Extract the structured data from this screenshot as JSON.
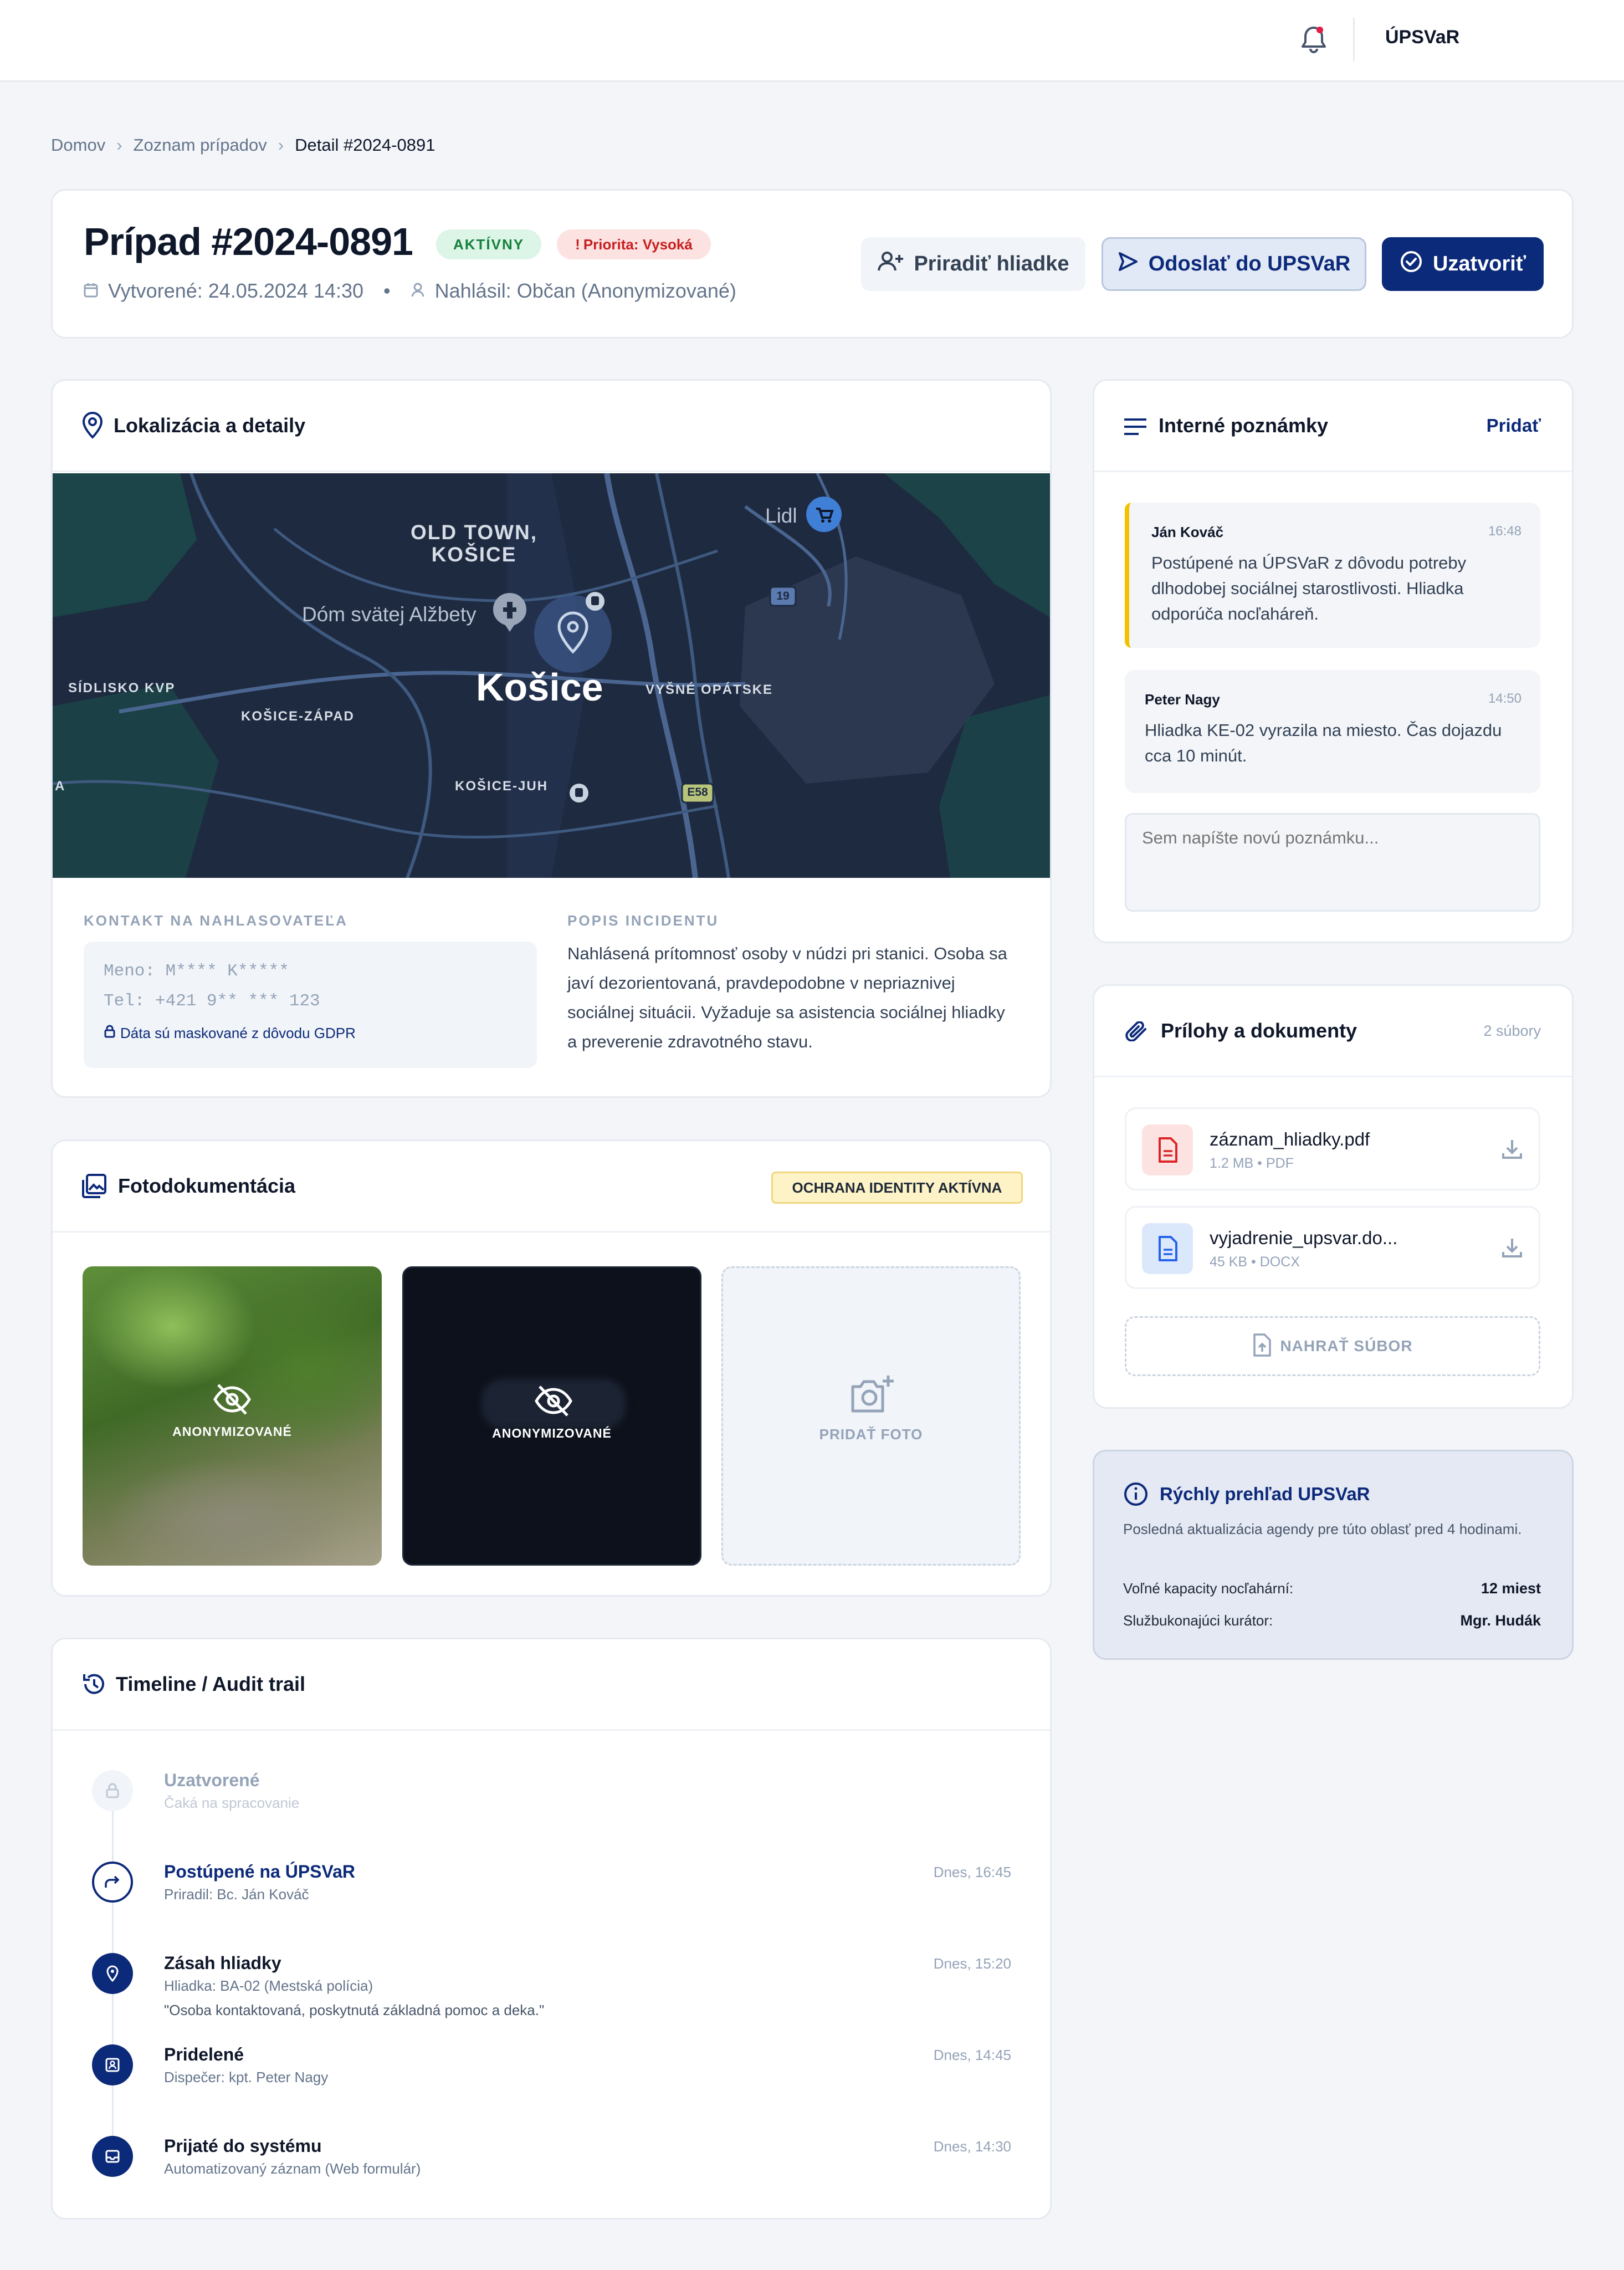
{
  "header": {
    "org_label": "ÚPSVaR"
  },
  "breadcrumb": {
    "items": [
      "Domov",
      "Zoznam prípadov",
      "Detail #2024-0891"
    ],
    "separator": "›"
  },
  "case": {
    "title": "Prípad #2024-0891",
    "status_badge": "AKTÍVNY",
    "priority_badge": "Priorita: Vysoká",
    "priority_mark": "!",
    "created": "Vytvorené: 24.05.2024 14:30",
    "meta_separator": "•",
    "reported_by": "Nahlásil: Občan (Anonymizované)",
    "actions": {
      "assign": "Priradiť hliadke",
      "send": "Odoslať do UPSVaR",
      "close": "Uzatvoriť"
    }
  },
  "location": {
    "title": "Lokalizácia a detaily",
    "map": {
      "city": "Košice",
      "old_town": "OLD TOWN,\nKOŠICE",
      "old_town_line1": "OLD TOWN,",
      "old_town_line2": "KOŠICE",
      "poi_1": "Dóm svätej Alžbety",
      "poi_2": "Lidl",
      "district_kvp": "SÍDLISKO KVP",
      "district_zapad": "KOŠICE-ZÁPAD",
      "district_juh": "KOŠICE-JUH",
      "district_opatske": "VYŠNÉ OPÁTSKE",
      "road_19": "19",
      "road_e58": "E58",
      "edge_letter": "A"
    },
    "contact": {
      "label": "KONTAKT NA NAHLASOVATEĽA",
      "name_line": "Meno: M**** K*****",
      "phone_line": "Tel: +421 9** *** 123",
      "gdpr_note": "Dáta sú maskované z dôvodu GDPR"
    },
    "description": {
      "label": "POPIS INCIDENTU",
      "text": "Nahlásená prítomnosť osoby v núdzi pri stanici. Osoba sa javí dezorientovaná, pravdepodobne v nepriaznivej sociálnej situácii. Vyžaduje sa asistencia sociálnej hliadky a preverenie zdravotného stavu."
    }
  },
  "photos": {
    "title": "Fotodokumentácia",
    "identity_badge": "OCHRANA IDENTITY AKTÍVNA",
    "anon_label_1": "ANONYMIZOVANÉ",
    "anon_label_2": "ANONYMIZOVANÉ",
    "add_photo": "PRIDAŤ FOTO"
  },
  "timeline": {
    "title": "Timeline / Audit trail",
    "items": [
      {
        "title": "Uzatvorené",
        "sub": "Čaká na spracovanie",
        "time": "",
        "icon": "lock-icon"
      },
      {
        "title": "Postúpené na ÚPSVaR",
        "sub": "Priradil: Bc. Ján Kováč",
        "time": "Dnes, 16:45",
        "icon": "forward-icon"
      },
      {
        "title": "Zásah hliadky",
        "sub": "Hliadka: BA-02 (Mestská polícia)",
        "quote": "\"Osoba kontaktovaná, poskytnutá základná pomoc a deka.\"",
        "time": "Dnes, 15:20",
        "icon": "location-icon"
      },
      {
        "title": "Pridelené",
        "sub": "Dispečer: kpt. Peter Nagy",
        "time": "Dnes, 14:45",
        "icon": "badge-icon"
      },
      {
        "title": "Prijaté do systému",
        "sub": "Automatizovaný záznam (Web formulár)",
        "time": "Dnes, 14:30",
        "icon": "inbox-icon"
      }
    ]
  },
  "notes": {
    "title": "Interné poznámky",
    "add_label": "Pridať",
    "items": [
      {
        "author": "Ján Kováč",
        "time": "16:48",
        "text": "Postúpené na ÚPSVaR z dôvodu potreby dlhodobej sociálnej starostlivosti. Hliadka odporúča nocľaháreň."
      },
      {
        "author": "Peter Nagy",
        "time": "14:50",
        "text": "Hliadka KE-02 vyrazila na miesto. Čas dojazdu cca 10 minút."
      }
    ],
    "input_placeholder": "Sem napíšte novú poznámku..."
  },
  "attachments": {
    "title": "Prílohy a dokumenty",
    "count": "2 súbory",
    "files": [
      {
        "name": "záznam_hliadky.pdf",
        "meta": "1.2 MB • PDF",
        "type": "pdf"
      },
      {
        "name": "vyjadrenie_upsvar.do...",
        "meta": "45 KB • DOCX",
        "type": "docx"
      }
    ],
    "upload_label": "NAHRAŤ SÚBOR"
  },
  "overview": {
    "title": "Rýchly prehľad UPSVaR",
    "subtitle": "Posledná aktualizácia agendy pre túto oblasť pred 4 hodinami.",
    "rows": [
      {
        "label": "Voľné kapacity nocľahární:",
        "value": "12 miest"
      },
      {
        "label": "Službukonajúci kurátor:",
        "value": "Mgr. Hudák"
      }
    ]
  },
  "colors": {
    "primary": "#0c2a7a",
    "accent_yellow": "#f2c200",
    "status_green_bg": "#dcf5e6",
    "status_green_fg": "#15803d",
    "priority_bg": "#fde2e2",
    "priority_fg": "#c81e1e",
    "map_bg": "#1e2a40",
    "page_bg": "#f3f5f8"
  }
}
